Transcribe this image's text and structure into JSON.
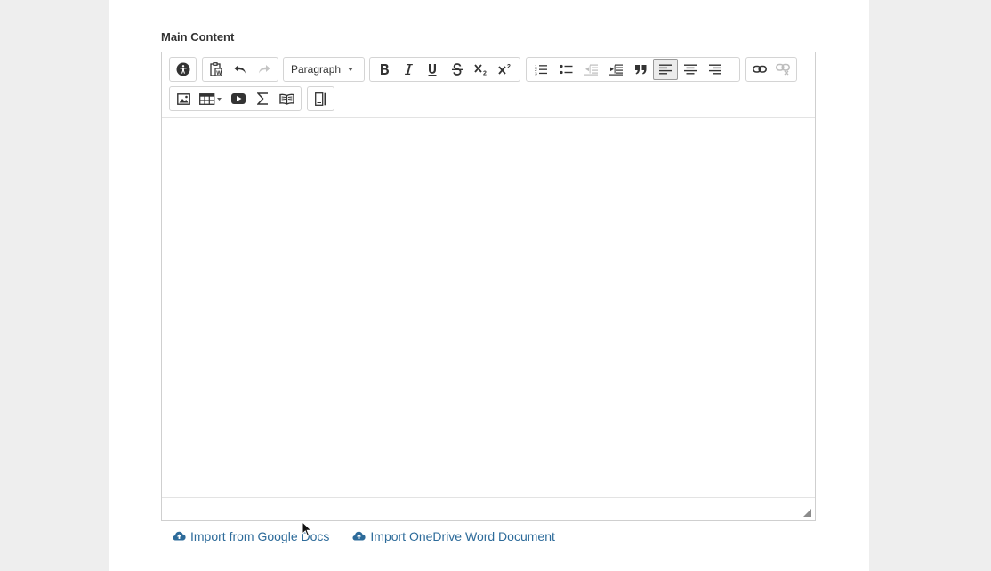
{
  "main_content": {
    "label": "Main Content"
  },
  "toolbar": {
    "format_select": "Paragraph",
    "buttons": [
      "accessibility-icon",
      "paste-from-word-icon",
      "undo-icon",
      "redo-icon",
      "bold-icon",
      "italic-icon",
      "underline-icon",
      "strikethrough-icon",
      "subscript-icon",
      "superscript-icon",
      "numbered-list-icon",
      "bulleted-list-icon",
      "decrease-indent-icon",
      "increase-indent-icon",
      "blockquote-icon",
      "align-left-icon",
      "align-center-icon",
      "align-right-icon",
      "insert-link-icon",
      "remove-link-icon",
      "insert-image-icon",
      "insert-table-icon",
      "insert-media-icon",
      "insert-equation-icon",
      "insert-glossary-icon",
      "toggle-fullscreen-icon"
    ],
    "active_button": "align-left-icon"
  },
  "imports": {
    "google_docs": "Import from Google Docs",
    "onedrive": "Import OneDrive Word Document"
  },
  "colors": {
    "link": "#2d6b9a",
    "page_background": "#eeeeee",
    "panel_background": "#ffffff"
  }
}
